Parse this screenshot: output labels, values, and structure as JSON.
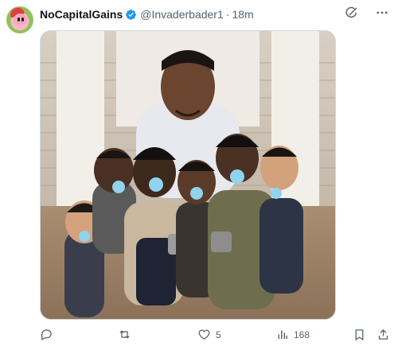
{
  "tweet": {
    "display_name": "NoCapitalGains",
    "handle": "@Invaderbader1",
    "separator": "·",
    "time": "18m",
    "icons": {
      "avatar": "kirby-avatar",
      "verified": "verified-badge-icon",
      "grok": "grok-icon",
      "more": "more-icon"
    },
    "media": {
      "kind": "meme photo"
    },
    "actions": {
      "reply_count": "",
      "retweet_count": "",
      "like_count": "5",
      "views_count": "168"
    }
  },
  "colors": {
    "verified_blue": "#1d9bf0",
    "secondary_text": "#536471",
    "primary_text": "#0f1419",
    "border": "#cfd9de"
  }
}
